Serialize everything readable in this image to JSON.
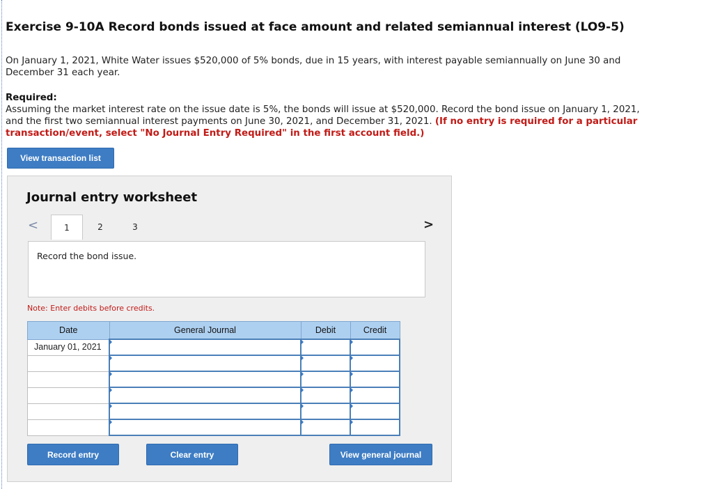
{
  "exercise": {
    "title": "Exercise 9-10A Record bonds issued at face amount and related semiannual interest (LO9-5)",
    "intro": "On January 1, 2021, White Water issues $520,000 of 5% bonds, due in 15 years, with interest payable semiannually on June 30 and December 31 each year.",
    "required_heading": "Required:",
    "required_text": "Assuming the market interest rate on the issue date is 5%, the bonds will issue at $520,000. Record the bond issue on January 1, 2021, and the first two semiannual interest payments on June 30, 2021, and December 31, 2021.",
    "required_instruction": "(If no entry is required for a particular transaction/event, select \"No Journal Entry Required\" in the first account field.)"
  },
  "buttons": {
    "view_transaction_list": "View transaction list",
    "record_entry": "Record entry",
    "clear_entry": "Clear entry",
    "view_general_journal": "View general journal"
  },
  "worksheet": {
    "title": "Journal entry worksheet",
    "prev_glyph": "<",
    "next_glyph": ">",
    "tabs": [
      "1",
      "2",
      "3"
    ],
    "active_tab": "1",
    "description": "Record the bond issue.",
    "note": "Note: Enter debits before credits."
  },
  "journal": {
    "headers": {
      "date": "Date",
      "general_journal": "General Journal",
      "debit": "Debit",
      "credit": "Credit"
    },
    "rows": [
      {
        "date": "January 01, 2021",
        "account": "",
        "debit": "",
        "credit": ""
      },
      {
        "date": "",
        "account": "",
        "debit": "",
        "credit": ""
      },
      {
        "date": "",
        "account": "",
        "debit": "",
        "credit": ""
      },
      {
        "date": "",
        "account": "",
        "debit": "",
        "credit": ""
      },
      {
        "date": "",
        "account": "",
        "debit": "",
        "credit": ""
      },
      {
        "date": "",
        "account": "",
        "debit": "",
        "credit": ""
      }
    ]
  },
  "colors": {
    "button_blue": "#3e7dc4",
    "header_blue": "#aed0f0",
    "instruction_red": "#c11b17",
    "panel_gray": "#efefef"
  }
}
